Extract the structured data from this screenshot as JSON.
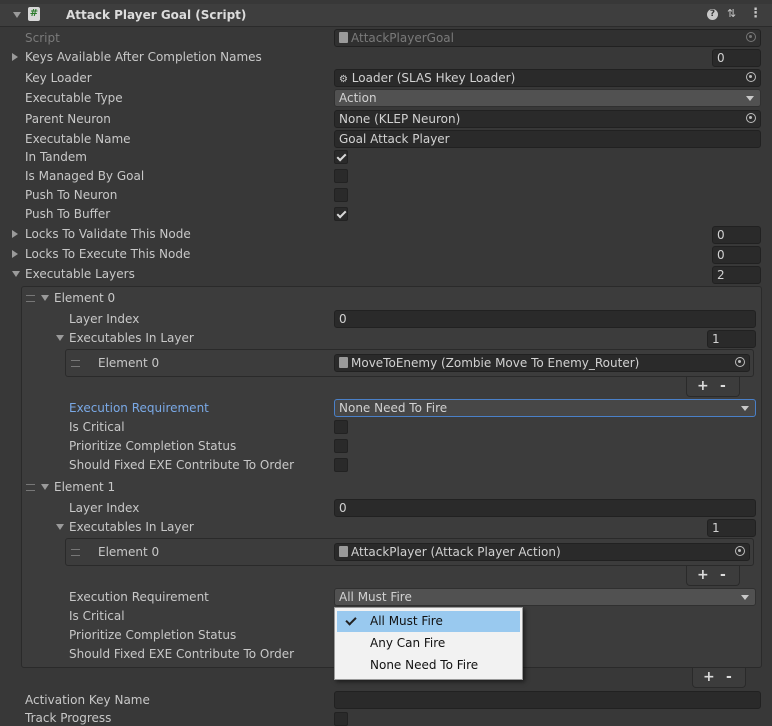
{
  "header": {
    "title": "Attack Player Goal (Script)",
    "help_icon": "help-icon",
    "settings_icon": "presets-icon",
    "menu_icon": "kebab-menu-icon"
  },
  "fields": {
    "script_label": "Script",
    "script_value": "AttackPlayerGoal",
    "keys_names_label": "Keys Available After Completion Names",
    "keys_names_count": "0",
    "key_loader_label": "Key Loader",
    "key_loader_value": "Loader (SLAS Hkey Loader)",
    "exec_type_label": "Executable Type",
    "exec_type_value": "Action",
    "parent_neuron_label": "Parent Neuron",
    "parent_neuron_value": "None (KLEP Neuron)",
    "exec_name_label": "Executable Name",
    "exec_name_value": "Goal Attack Player",
    "in_tandem_label": "In Tandem",
    "managed_label": "Is Managed By Goal",
    "push_neuron_label": "Push To Neuron",
    "push_buffer_label": "Push To Buffer",
    "locks_validate_label": "Locks To Validate This Node",
    "locks_validate_count": "0",
    "locks_execute_label": "Locks To Execute This Node",
    "locks_execute_count": "0",
    "layers_label": "Executable Layers",
    "layers_count": "2"
  },
  "element0": {
    "title": "Element 0",
    "layer_index_label": "Layer Index",
    "layer_index_value": "0",
    "executables_label": "Executables In Layer",
    "executables_count": "1",
    "inner_label": "Element 0",
    "inner_value": "MoveToEnemy (Zombie Move To Enemy_Router)",
    "req_label": "Execution Requirement",
    "req_value": "None Need To Fire",
    "critical_label": "Is Critical",
    "prioritize_label": "Prioritize Completion Status",
    "fixed_label": "Should Fixed EXE Contribute To Order"
  },
  "element1": {
    "title": "Element 1",
    "layer_index_label": "Layer Index",
    "layer_index_value": "0",
    "executables_label": "Executables In Layer",
    "executables_count": "1",
    "inner_label": "Element 0",
    "inner_value": "AttackPlayer (Attack Player Action)",
    "req_label": "Execution Requirement",
    "req_value": "All Must Fire",
    "critical_label": "Is Critical",
    "prioritize_label": "Prioritize Completion Status",
    "fixed_label": "Should Fixed EXE Contribute To Order"
  },
  "list_buttons": {
    "add": "+",
    "remove": "-"
  },
  "bottom": {
    "activation_label": "Activation Key Name",
    "activation_value": "",
    "track_label": "Track Progress"
  },
  "dropdown_menu": {
    "options": [
      "All Must Fire",
      "Any Can Fire",
      "None Need To Fire"
    ],
    "selected": "All Must Fire"
  },
  "checkbox_states": {
    "in_tandem": true,
    "managed_by_goal": false,
    "push_to_neuron": false,
    "push_to_buffer": true
  },
  "colors": {
    "background": "#383838",
    "field": "#2a2a2a",
    "highlight_label": "#7aa9e6",
    "menu_selected": "#99c9ef"
  }
}
